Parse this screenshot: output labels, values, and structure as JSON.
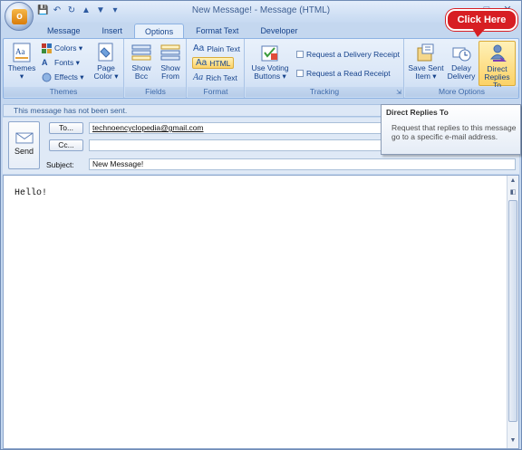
{
  "window": {
    "title": "New Message! - Message (HTML)",
    "controls": [
      "–",
      "□",
      "✕"
    ]
  },
  "office_button": {
    "letter": "o"
  },
  "quick_access": [
    "💾",
    "↶",
    "↻",
    "▲",
    "▼",
    "▾"
  ],
  "tabs": [
    "Message",
    "Insert",
    "Options",
    "Format Text",
    "Developer"
  ],
  "ribbon": {
    "themes": {
      "label": "Themes",
      "themes_button": "Themes",
      "colors": "Colors ▾",
      "fonts": "Fonts ▾",
      "effects": "Effects ▾",
      "page_color": "Page Color ▾"
    },
    "fields": {
      "label": "Fields",
      "show_bcc": "Show Bcc",
      "show_from": "Show From"
    },
    "format": {
      "label": "Format",
      "plain_text": "Plain Text",
      "html": "HTML",
      "rich_text": "Rich Text",
      "aa": "Aa"
    },
    "tracking": {
      "label": "Tracking",
      "voting": "Use Voting Buttons ▾",
      "delivery_receipt": "Request a Delivery Receipt",
      "read_receipt": "Request a Read Receipt"
    },
    "more_options": {
      "label": "More Options",
      "save_sent": "Save Sent Item ▾",
      "delay": "Delay Delivery",
      "direct_replies": "Direct Replies To"
    }
  },
  "callout": {
    "text": "Click Here",
    "color": "#d71e23"
  },
  "infobar": {
    "text": "This message has not been sent."
  },
  "tooltip": {
    "title": "Direct Replies To",
    "body": "Request that replies to this message go to a specific e-mail address."
  },
  "header": {
    "send": "Send",
    "to_button": "To...",
    "cc_button": "Cc...",
    "subject_label": "Subject:",
    "to_value": "technoencyclopedia@gmail.com",
    "cc_value": "",
    "subject_value": "New Message!"
  },
  "body": {
    "text": "Hello!"
  }
}
